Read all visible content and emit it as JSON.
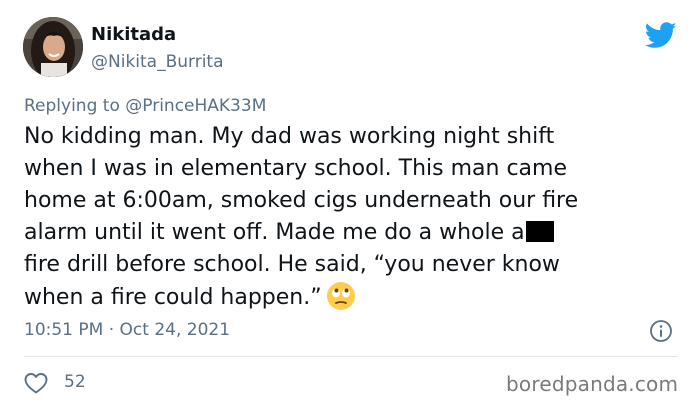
{
  "author": {
    "display_name": "Nikitada",
    "handle": "@Nikita_Burrita"
  },
  "reply": {
    "prefix": "Replying to",
    "mention": "@PrinceHAK33M"
  },
  "tweet": {
    "lines": [
      "No kidding man. My dad was working night shift",
      "when I was in elementary school. This man came",
      "home at 6:00am, smoked cigs underneath our fire",
      "alarm until it went off. Made me do a whole a",
      "fire drill before school. He said, “you never know",
      "when a fire could happen.”"
    ],
    "emoji": "face-with-rolling-eyes"
  },
  "timestamp": {
    "time": "10:51 PM",
    "separator": "·",
    "date": "Oct 24, 2021"
  },
  "engagement": {
    "likes": "52"
  },
  "watermark": "boredpanda.com",
  "colors": {
    "twitter_blue": "#1da1f2",
    "secondary_text": "#5b7083",
    "divider": "#e1e8ed"
  }
}
